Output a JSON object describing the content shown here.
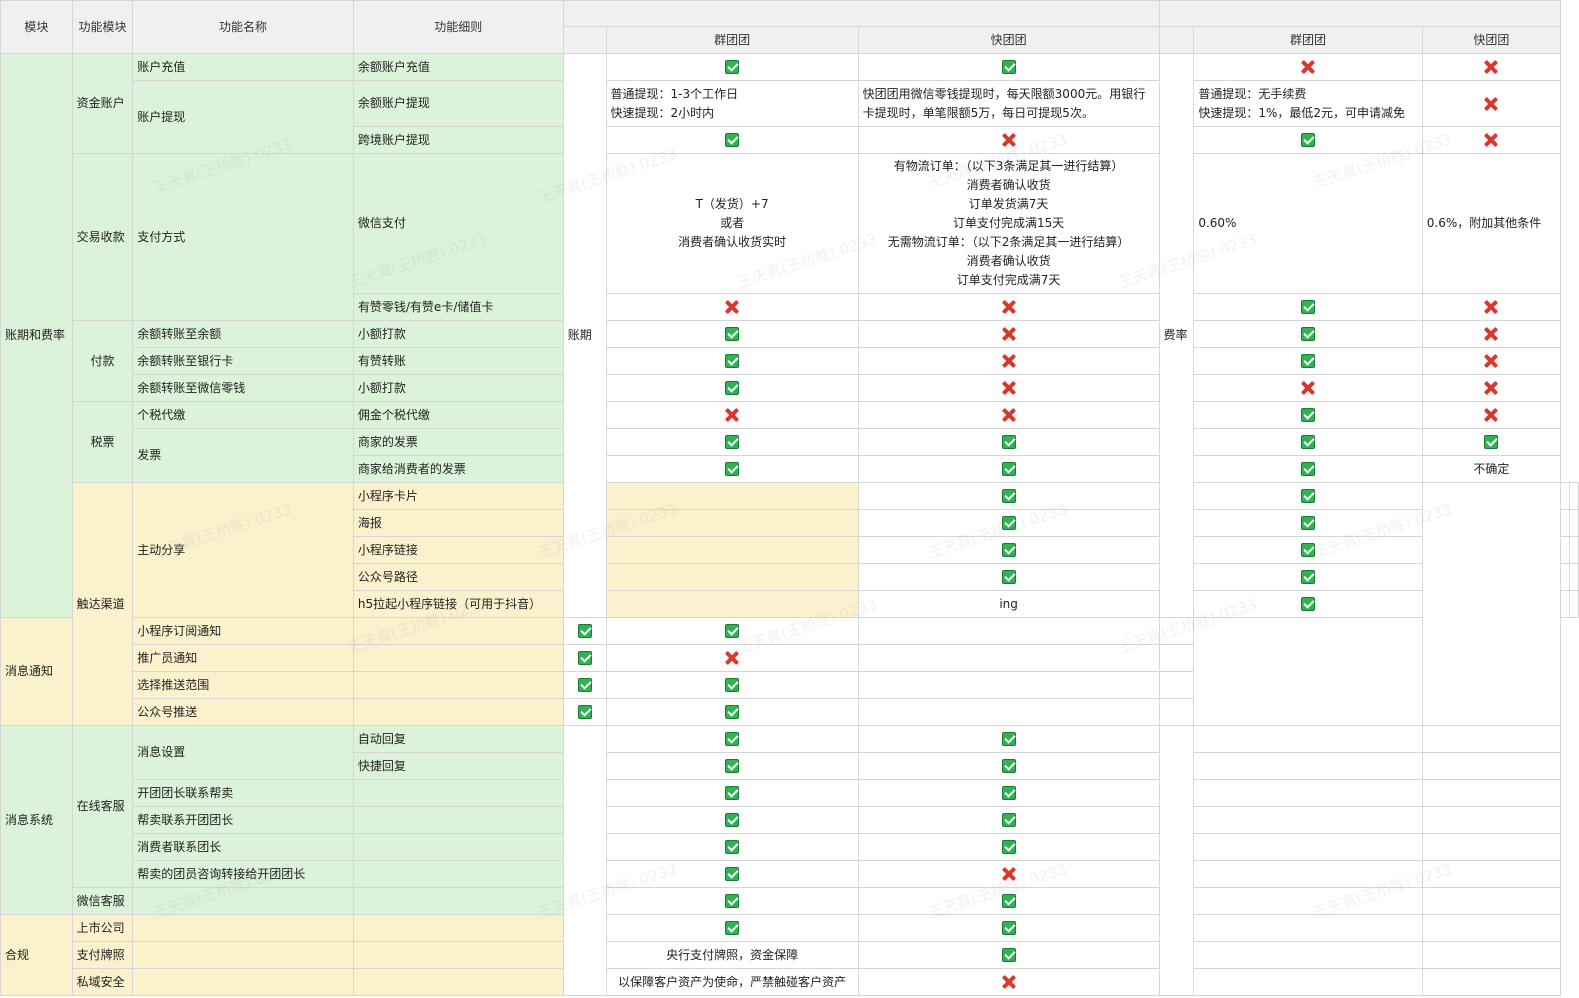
{
  "columns": [
    "模块",
    "功能模块",
    "功能名称",
    "功能细则",
    "",
    "群团团",
    "快团团",
    "",
    "群团团",
    "快团团"
  ],
  "labels": {
    "settlement": "账期",
    "fee": "费率"
  },
  "modules": [
    "账期和费率",
    "触达渠道",
    "消息系统",
    "合规"
  ],
  "features": [
    "资金账户",
    "交易收款",
    "付款",
    "税票",
    "主动分享",
    "消息通知",
    "在线客服",
    "微信客服",
    "上市公司",
    "支付牌照",
    "私域安全"
  ],
  "names": [
    "账户充值",
    "账户提现",
    "支付方式",
    "余额转账至余额",
    "余额转账至银行卡",
    "余额转账至微信零钱",
    "个税代缴",
    "发票",
    "小程序卡片",
    "海报",
    "小程序链接",
    "公众号路径",
    "h5拉起小程序链接（可用于抖音）",
    "小程序订阅通知",
    "推广员通知",
    "选择推送范围",
    "公众号推送",
    "消息设置",
    "开团团长联系帮卖",
    "帮卖联系开团团长",
    "消费者联系团长",
    "帮卖的团员咨询转接给开团团长"
  ],
  "details": [
    "余额账户充值",
    "余额账户提现",
    "跨境账户提现",
    "微信支付",
    "有赞零钱/有赞e卡/储值卡",
    "小额打款",
    "有赞转账",
    "小额打款",
    "佣金个税代缴",
    "商家的发票",
    "商家给消费者的发票",
    "自动回复",
    "快捷回复"
  ],
  "notes": {
    "qt_withdraw": [
      "普通提现：1-3个工作日",
      "快速提现：2小时内"
    ],
    "kt_withdraw": [
      "快团团用微信零钱提现时，每天限额3000元。用银行卡提现时，单笔限额5万，每日可提现5次。"
    ],
    "qt_wechat": [
      "T（发货）+7",
      "或者",
      "消费者确认收货实时"
    ],
    "kt_wechat": [
      "有物流订单：（以下3条满足其一进行结算）",
      "消费者确认收货",
      "订单发货满7天",
      "订单支付完成满15天",
      "无需物流订单：（以下2条满足其一进行结算）",
      "消费者确认收货",
      "订单支付完成满7天"
    ],
    "qt_fee_withdraw": [
      "普通提现：无手续费",
      "快速提现：1%，最低2元，可申请减免"
    ],
    "qt_fee_wechat": "0.60%",
    "kt_fee_wechat": "0.6%，附加其他条件",
    "kt_fee_invoice": "不确定",
    "h5": "ing",
    "license": "央行支付牌照，资金保障",
    "security": "以保障客户资产为使命，严禁触碰客户资产"
  },
  "watermark": "王天真(王桥胜) 0233",
  "colors": {
    "green": "#dbf3d9",
    "yellow": "#fbf1cd",
    "check": "#2fb451",
    "cross": "#d63a2d"
  }
}
